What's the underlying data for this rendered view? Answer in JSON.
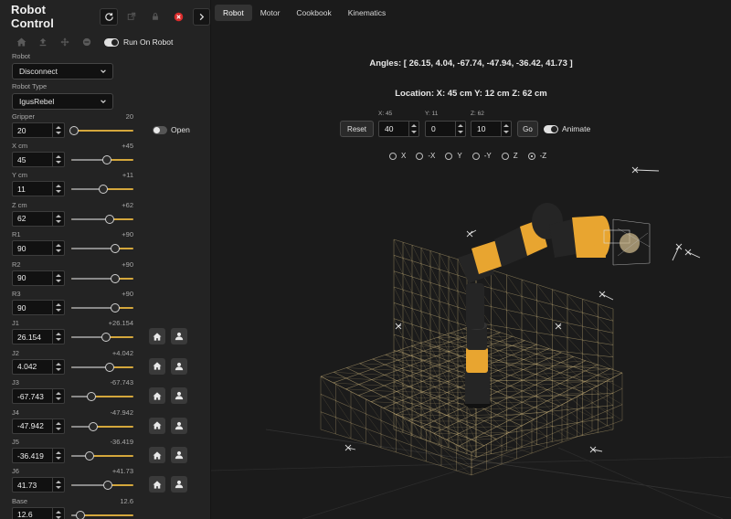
{
  "app": {
    "title": "Robot Control",
    "run_on_robot_label": "Run On Robot",
    "run_on_robot": true
  },
  "robot": {
    "label": "Robot",
    "value": "Disconnect"
  },
  "robot_type": {
    "label": "Robot Type",
    "value": "IgusRebel"
  },
  "gripper": {
    "label": "Gripper",
    "display": "20",
    "value": "20",
    "fraction": 0.05,
    "toggle_label": "Open",
    "toggle_on": false
  },
  "controls": [
    {
      "name": "x",
      "label": "X cm",
      "display": "+45",
      "value": "45",
      "fraction": 0.57,
      "joint": false
    },
    {
      "name": "y",
      "label": "Y cm",
      "display": "+11",
      "value": "11",
      "fraction": 0.51,
      "joint": false
    },
    {
      "name": "z",
      "label": "Z cm",
      "display": "+62",
      "value": "62",
      "fraction": 0.62,
      "joint": false
    },
    {
      "name": "r1",
      "label": "R1",
      "display": "+90",
      "value": "90",
      "fraction": 0.7,
      "joint": false
    },
    {
      "name": "r2",
      "label": "R2",
      "display": "+90",
      "value": "90",
      "fraction": 0.7,
      "joint": false
    },
    {
      "name": "r3",
      "label": "R3",
      "display": "+90",
      "value": "90",
      "fraction": 0.7,
      "joint": false
    },
    {
      "name": "j1",
      "label": "J1",
      "display": "+26.154",
      "value": "26.154",
      "fraction": 0.56,
      "joint": true
    },
    {
      "name": "j2",
      "label": "J2",
      "display": "+4.042",
      "value": "4.042",
      "fraction": 0.62,
      "joint": true
    },
    {
      "name": "j3",
      "label": "J3",
      "display": "-67.743",
      "value": "-67.743",
      "fraction": 0.32,
      "joint": true
    },
    {
      "name": "j4",
      "label": "J4",
      "display": "-47.942",
      "value": "-47.942",
      "fraction": 0.36,
      "joint": true
    },
    {
      "name": "j5",
      "label": "J5",
      "display": "-36.419",
      "value": "-36.419",
      "fraction": 0.3,
      "joint": true
    },
    {
      "name": "j6",
      "label": "J6",
      "display": "+41.73",
      "value": "41.73",
      "fraction": 0.59,
      "joint": true
    },
    {
      "name": "base",
      "label": "Base",
      "display": "12.6",
      "value": "12.6",
      "fraction": 0.15,
      "joint": false
    }
  ],
  "tabs": [
    {
      "label": "Robot",
      "active": true
    },
    {
      "label": "Motor",
      "active": false
    },
    {
      "label": "Cookbook",
      "active": false
    },
    {
      "label": "Kinematics",
      "active": false
    }
  ],
  "readout": {
    "angles": "Angles: [ 26.15, 4.04, -67.74, -47.94, -36.42, 41.73 ]",
    "location": "Location: X: 45 cm Y: 12 cm Z: 62 cm"
  },
  "move": {
    "reset_label": "Reset",
    "x_label": "X: 45",
    "x_value": "40",
    "y_label": "Y: 11",
    "y_value": "0",
    "z_label": "Z: 62",
    "z_value": "10",
    "go_label": "Go",
    "animate_label": "Animate",
    "animate_on": true
  },
  "axes": [
    {
      "label": "X",
      "selected": false
    },
    {
      "label": "-X",
      "selected": false
    },
    {
      "label": "Y",
      "selected": false
    },
    {
      "label": "-Y",
      "selected": false
    },
    {
      "label": "Z",
      "selected": false
    },
    {
      "label": "-Z",
      "selected": true
    }
  ],
  "colors": {
    "accent": "#d4a73c",
    "robot_orange": "#e8a530",
    "robot_dark": "#252525",
    "stop_red": "#d92b2b",
    "grid": "#c9b27a"
  }
}
